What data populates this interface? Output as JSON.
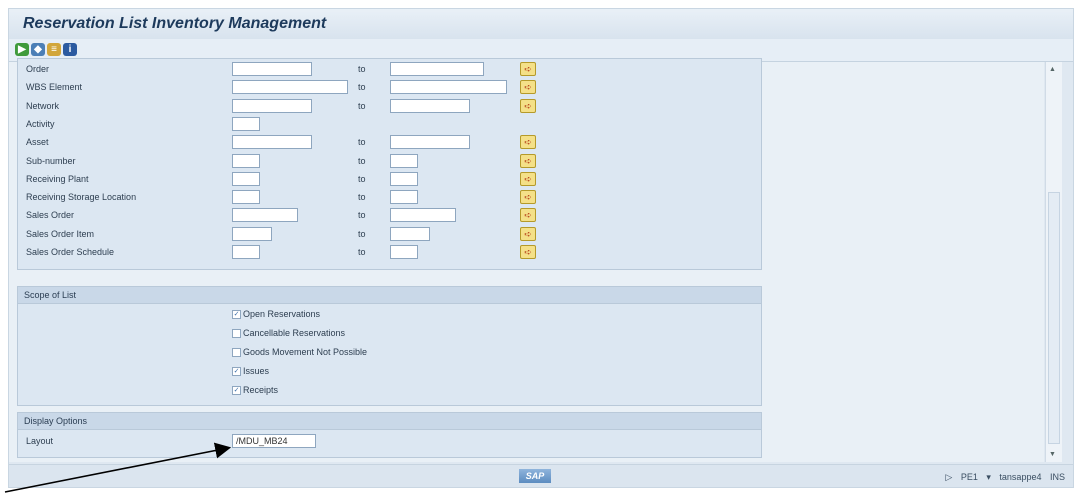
{
  "window": {
    "title": "Reservation List Inventory Management"
  },
  "toolbar": {
    "icons": [
      "execute-icon",
      "get-variant-icon",
      "selection-options-icon",
      "info-icon"
    ]
  },
  "selection": {
    "rows": [
      {
        "label": "Order",
        "to": "to"
      },
      {
        "label": "WBS Element",
        "to": "to"
      },
      {
        "label": "Network",
        "to": "to"
      },
      {
        "label": "Activity",
        "to": ""
      },
      {
        "label": "Asset",
        "to": "to"
      },
      {
        "label": "Sub-number",
        "to": "to"
      },
      {
        "label": "Receiving Plant",
        "to": "to"
      },
      {
        "label": "Receiving Storage Location",
        "to": "to"
      },
      {
        "label": "Sales Order",
        "to": "to"
      },
      {
        "label": "Sales Order Item",
        "to": "to"
      },
      {
        "label": "Sales Order Schedule",
        "to": "to"
      }
    ]
  },
  "scope": {
    "title": "Scope of List",
    "options": [
      {
        "label": "Open Reservations",
        "checked": "✓"
      },
      {
        "label": "Cancellable Reservations",
        "checked": ""
      },
      {
        "label": "Goods Movement Not Possible",
        "checked": ""
      },
      {
        "label": "Issues",
        "checked": "✓"
      },
      {
        "label": "Receipts",
        "checked": "✓"
      }
    ]
  },
  "display": {
    "title": "Display Options",
    "layout_label": "Layout",
    "layout_value": "/MDU_MB24"
  },
  "statusbar": {
    "sap": "SAP",
    "system": "PE1",
    "user": "tansappe4",
    "mode": "INS"
  }
}
